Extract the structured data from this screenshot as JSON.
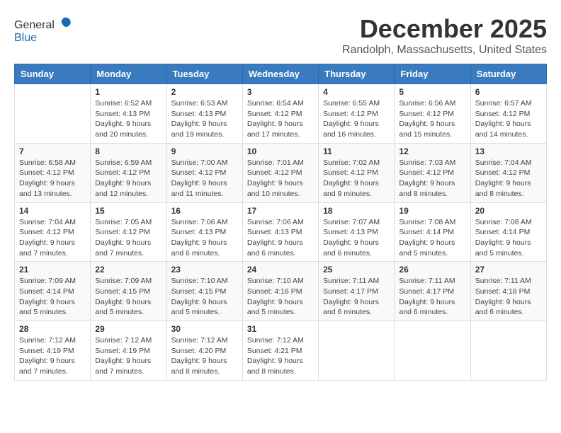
{
  "header": {
    "logo_general": "General",
    "logo_blue": "Blue",
    "month_title": "December 2025",
    "location": "Randolph, Massachusetts, United States"
  },
  "weekdays": [
    "Sunday",
    "Monday",
    "Tuesday",
    "Wednesday",
    "Thursday",
    "Friday",
    "Saturday"
  ],
  "weeks": [
    [
      {
        "day": "",
        "info": ""
      },
      {
        "day": "1",
        "info": "Sunrise: 6:52 AM\nSunset: 4:13 PM\nDaylight: 9 hours\nand 20 minutes."
      },
      {
        "day": "2",
        "info": "Sunrise: 6:53 AM\nSunset: 4:13 PM\nDaylight: 9 hours\nand 19 minutes."
      },
      {
        "day": "3",
        "info": "Sunrise: 6:54 AM\nSunset: 4:12 PM\nDaylight: 9 hours\nand 17 minutes."
      },
      {
        "day": "4",
        "info": "Sunrise: 6:55 AM\nSunset: 4:12 PM\nDaylight: 9 hours\nand 16 minutes."
      },
      {
        "day": "5",
        "info": "Sunrise: 6:56 AM\nSunset: 4:12 PM\nDaylight: 9 hours\nand 15 minutes."
      },
      {
        "day": "6",
        "info": "Sunrise: 6:57 AM\nSunset: 4:12 PM\nDaylight: 9 hours\nand 14 minutes."
      }
    ],
    [
      {
        "day": "7",
        "info": "Sunrise: 6:58 AM\nSunset: 4:12 PM\nDaylight: 9 hours\nand 13 minutes."
      },
      {
        "day": "8",
        "info": "Sunrise: 6:59 AM\nSunset: 4:12 PM\nDaylight: 9 hours\nand 12 minutes."
      },
      {
        "day": "9",
        "info": "Sunrise: 7:00 AM\nSunset: 4:12 PM\nDaylight: 9 hours\nand 11 minutes."
      },
      {
        "day": "10",
        "info": "Sunrise: 7:01 AM\nSunset: 4:12 PM\nDaylight: 9 hours\nand 10 minutes."
      },
      {
        "day": "11",
        "info": "Sunrise: 7:02 AM\nSunset: 4:12 PM\nDaylight: 9 hours\nand 9 minutes."
      },
      {
        "day": "12",
        "info": "Sunrise: 7:03 AM\nSunset: 4:12 PM\nDaylight: 9 hours\nand 8 minutes."
      },
      {
        "day": "13",
        "info": "Sunrise: 7:04 AM\nSunset: 4:12 PM\nDaylight: 9 hours\nand 8 minutes."
      }
    ],
    [
      {
        "day": "14",
        "info": "Sunrise: 7:04 AM\nSunset: 4:12 PM\nDaylight: 9 hours\nand 7 minutes."
      },
      {
        "day": "15",
        "info": "Sunrise: 7:05 AM\nSunset: 4:12 PM\nDaylight: 9 hours\nand 7 minutes."
      },
      {
        "day": "16",
        "info": "Sunrise: 7:06 AM\nSunset: 4:13 PM\nDaylight: 9 hours\nand 6 minutes."
      },
      {
        "day": "17",
        "info": "Sunrise: 7:06 AM\nSunset: 4:13 PM\nDaylight: 9 hours\nand 6 minutes."
      },
      {
        "day": "18",
        "info": "Sunrise: 7:07 AM\nSunset: 4:13 PM\nDaylight: 9 hours\nand 6 minutes."
      },
      {
        "day": "19",
        "info": "Sunrise: 7:08 AM\nSunset: 4:14 PM\nDaylight: 9 hours\nand 5 minutes."
      },
      {
        "day": "20",
        "info": "Sunrise: 7:08 AM\nSunset: 4:14 PM\nDaylight: 9 hours\nand 5 minutes."
      }
    ],
    [
      {
        "day": "21",
        "info": "Sunrise: 7:09 AM\nSunset: 4:14 PM\nDaylight: 9 hours\nand 5 minutes."
      },
      {
        "day": "22",
        "info": "Sunrise: 7:09 AM\nSunset: 4:15 PM\nDaylight: 9 hours\nand 5 minutes."
      },
      {
        "day": "23",
        "info": "Sunrise: 7:10 AM\nSunset: 4:15 PM\nDaylight: 9 hours\nand 5 minutes."
      },
      {
        "day": "24",
        "info": "Sunrise: 7:10 AM\nSunset: 4:16 PM\nDaylight: 9 hours\nand 5 minutes."
      },
      {
        "day": "25",
        "info": "Sunrise: 7:11 AM\nSunset: 4:17 PM\nDaylight: 9 hours\nand 6 minutes."
      },
      {
        "day": "26",
        "info": "Sunrise: 7:11 AM\nSunset: 4:17 PM\nDaylight: 9 hours\nand 6 minutes."
      },
      {
        "day": "27",
        "info": "Sunrise: 7:11 AM\nSunset: 4:18 PM\nDaylight: 9 hours\nand 6 minutes."
      }
    ],
    [
      {
        "day": "28",
        "info": "Sunrise: 7:12 AM\nSunset: 4:19 PM\nDaylight: 9 hours\nand 7 minutes."
      },
      {
        "day": "29",
        "info": "Sunrise: 7:12 AM\nSunset: 4:19 PM\nDaylight: 9 hours\nand 7 minutes."
      },
      {
        "day": "30",
        "info": "Sunrise: 7:12 AM\nSunset: 4:20 PM\nDaylight: 9 hours\nand 8 minutes."
      },
      {
        "day": "31",
        "info": "Sunrise: 7:12 AM\nSunset: 4:21 PM\nDaylight: 9 hours\nand 8 minutes."
      },
      {
        "day": "",
        "info": ""
      },
      {
        "day": "",
        "info": ""
      },
      {
        "day": "",
        "info": ""
      }
    ]
  ]
}
